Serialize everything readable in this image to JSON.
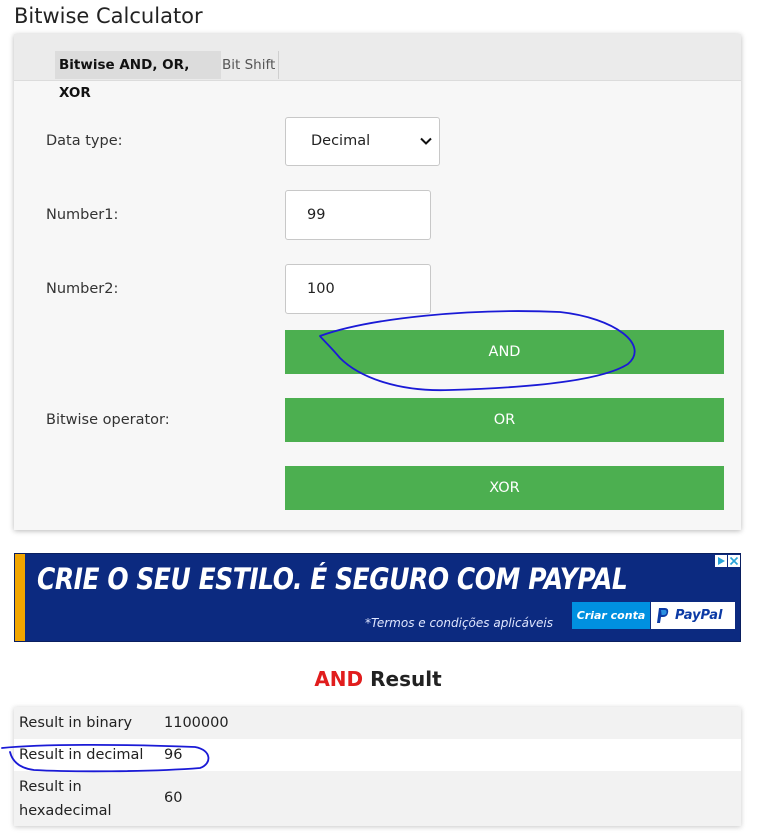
{
  "page": {
    "title": "Bitwise Calculator"
  },
  "tabs": [
    {
      "label": "Bitwise AND, OR, XOR",
      "active": true
    },
    {
      "label": "Bit Shift",
      "active": false
    }
  ],
  "form": {
    "data_type_label": "Data type:",
    "data_type_value": "Decimal",
    "number1_label": "Number1:",
    "number1_value": "99",
    "number2_label": "Number2:",
    "number2_value": "100",
    "operator_label": "Bitwise operator:",
    "operators": [
      "AND",
      "OR",
      "XOR"
    ]
  },
  "ad": {
    "headline": "CRIE O SEU ESTILO. É SEGURO COM PAYPAL",
    "terms": "*Termos e condições aplicáveis",
    "cta": "Criar conta",
    "brand": "PayPal"
  },
  "result": {
    "operator": "AND",
    "title_suffix": "Result",
    "rows": [
      {
        "label": "Result in binary",
        "value": "1100000"
      },
      {
        "label": "Result in decimal",
        "value": "96"
      },
      {
        "label": "Result in hexadecimal",
        "value": "60"
      }
    ]
  },
  "colors": {
    "button_green": "#4caf50",
    "operator_red": "#e11d1d",
    "ad_blue": "#0c2a80",
    "annotation_ink": "#1a1ad6"
  },
  "icons": [
    "chevron-down-icon",
    "ad-choices-icon",
    "close-icon",
    "paypal-logo"
  ]
}
